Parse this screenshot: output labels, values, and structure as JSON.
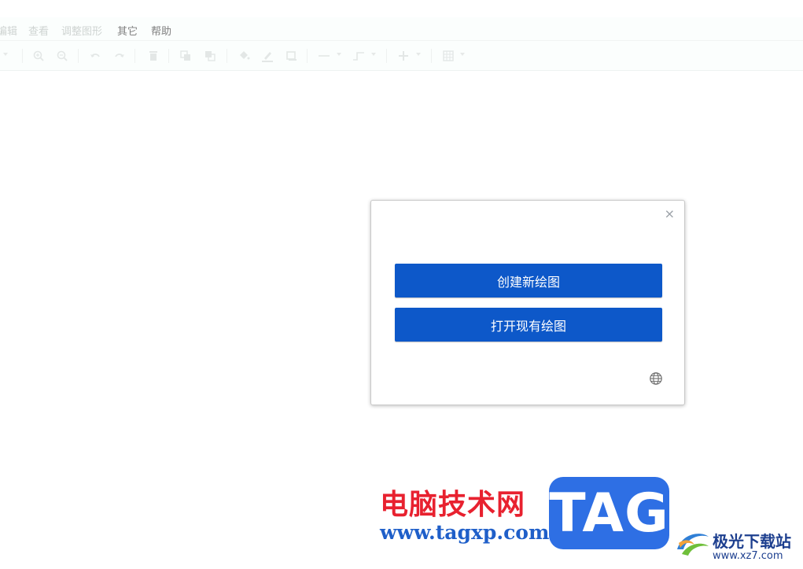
{
  "menu": {
    "items": [
      {
        "label": "编辑",
        "active": false
      },
      {
        "label": "查看",
        "active": false
      },
      {
        "label": "调整图形",
        "active": false
      },
      {
        "label": "其它",
        "active": true
      },
      {
        "label": "帮助",
        "active": true
      }
    ]
  },
  "toolbar": {
    "icons": [
      "zoom-in-icon",
      "zoom-out-icon",
      "undo-icon",
      "redo-icon",
      "delete-icon",
      "to-front-icon",
      "to-back-icon",
      "fill-color-icon",
      "line-color-icon",
      "shadow-icon",
      "connection-icon",
      "waypoints-icon",
      "insert-icon",
      "table-icon"
    ]
  },
  "dialog": {
    "close_label": "×",
    "create_label": "创建新绘图",
    "open_label": "打开现有绘图"
  },
  "watermark": {
    "site_name": "电脑技术网",
    "site_url": "www.tagxp.com",
    "tag_label": "TAG",
    "site_name_2": "极光下载站",
    "site_url_2": "www.xz7.com"
  },
  "colors": {
    "primary_button": "#0d58c9",
    "watermark_red": "#e8212f",
    "watermark_blue": "#2e6fe4"
  }
}
